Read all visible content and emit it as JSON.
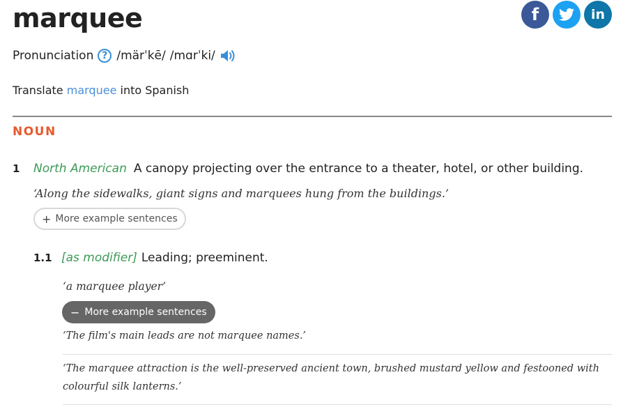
{
  "entry": {
    "headword": "marquee",
    "pronunciation_label": "Pronunciation",
    "pronunciation_help_symbol": "?",
    "ipa_us": "/märˈkē/",
    "ipa": "/mɑrˈki/",
    "translate_prefix": "Translate ",
    "translate_word": "marquee",
    "translate_suffix": " into Spanish",
    "part_of_speech": "NOUN"
  },
  "share": {
    "facebook_label": "f",
    "twitter_icon": "twitter-bird-icon",
    "linkedin_label": "in",
    "colors": {
      "facebook": "#3b5998",
      "twitter": "#1da1f2",
      "linkedin": "#0e76a8"
    }
  },
  "senses": [
    {
      "number": "1",
      "region": "North American",
      "definition": "A canopy projecting over the entrance to a theater, hotel, or other building.",
      "example": "‘Along the sidewalks, giant signs and marquees hung from the buildings.’",
      "more_button_sign": "+",
      "more_button_label": "More example sentences"
    }
  ],
  "subsenses": [
    {
      "number": "1.1",
      "grammar": "[as modifier]",
      "definition": "Leading; preeminent.",
      "example": "‘a marquee player’",
      "less_button_sign": "−",
      "less_button_label": "More example sentences",
      "extra_examples": [
        "‘The film's main leads are not marquee names.’",
        "‘The marquee attraction is the well-preserved ancient town, brushed mustard yellow and festooned with colourful silk lanterns.’"
      ]
    }
  ],
  "colors": {
    "accent_orange": "#e55b2d",
    "link_blue": "#4a90d9",
    "label_green": "#3c9a57"
  }
}
